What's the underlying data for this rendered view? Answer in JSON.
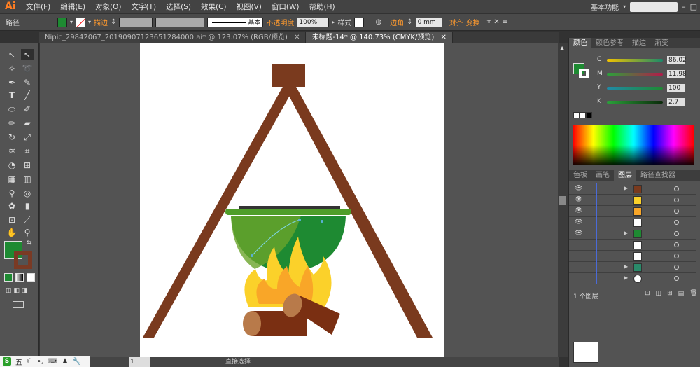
{
  "app": {
    "logo": "Ai"
  },
  "menu": [
    "文件(F)",
    "编辑(E)",
    "对象(O)",
    "文字(T)",
    "选择(S)",
    "效果(C)",
    "视图(V)",
    "窗口(W)",
    "帮助(H)"
  ],
  "workspace": "基本功能",
  "control_bar": {
    "selection_type": "路径",
    "stroke_label": "描边",
    "stroke_style": "基本",
    "opacity_label": "不透明度",
    "opacity_value": "100%",
    "style_label": "样式",
    "corner_label": "边角",
    "corner_value": "0 mm",
    "align_label": "对齐",
    "transform_label": "变换",
    "fill_color": "#1e8a32"
  },
  "doc_tabs": [
    "Nipic_29842067_20190907123651284000.ai* @ 123.07% (RGB/预览)",
    "未标题-14* @ 140.73% (CMYK/预览)"
  ],
  "status": {
    "zoom": "1",
    "tool": "直接选择"
  },
  "color_panel": {
    "tabs": [
      "颜色",
      "颜色参考",
      "描边",
      "渐变"
    ],
    "channels": [
      {
        "label": "C",
        "value": "86.02"
      },
      {
        "label": "M",
        "value": "11.98"
      },
      {
        "label": "Y",
        "value": "100"
      },
      {
        "label": "K",
        "value": "2.7"
      }
    ]
  },
  "layers_panel": {
    "tabs": [
      "色板",
      "画笔",
      "图层",
      "路径查找器"
    ],
    "footer": "1 个图层"
  },
  "taskbar": {
    "input_mode": "五"
  }
}
